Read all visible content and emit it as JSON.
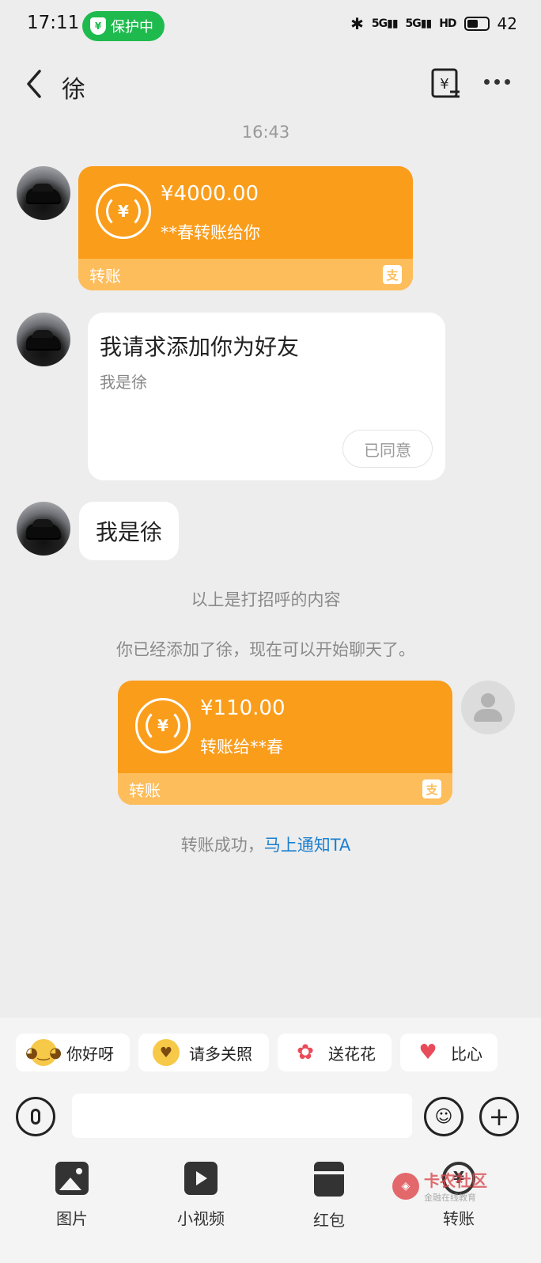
{
  "status_bar": {
    "time": "17:11",
    "protection_label": "保护中",
    "signal1": "5G",
    "signal2": "5G",
    "hd": "HD",
    "battery": "42"
  },
  "header": {
    "title": "徐"
  },
  "messages": {
    "time_separator": "16:43",
    "transfer_in": {
      "amount": "¥4000.00",
      "description": "**春转账给你",
      "label": "转账"
    },
    "friend_request": {
      "title": "我请求添加你为好友",
      "subtitle": "我是徐",
      "button": "已同意"
    },
    "text_message": "我是徐",
    "system_greeting": "以上是打招呼的内容",
    "system_added": "你已经添加了徐，现在可以开始聊天了。",
    "transfer_out": {
      "amount": "¥110.00",
      "description": "转账给**春",
      "label": "转账"
    },
    "transfer_status": "转账成功，",
    "notify_link": "马上通知TA"
  },
  "quick_replies": [
    {
      "label": "你好呀",
      "icon": "smile-emoji-icon"
    },
    {
      "label": "请多关照",
      "icon": "hug-emoji-icon"
    },
    {
      "label": "送花花",
      "icon": "flower-icon"
    },
    {
      "label": "比心",
      "icon": "finger-heart-icon"
    }
  ],
  "toolbar": {
    "photo": "图片",
    "video": "小视频",
    "red_packet": "红包",
    "transfer": "转账"
  },
  "watermark": {
    "brand": "卡农社区",
    "sub": "金融在线教育"
  },
  "colors": {
    "transfer_orange": "#fa9d1b",
    "transfer_footer": "#fdbd5b",
    "link_blue": "#1b7fcf",
    "protect_green": "#1fba4e"
  }
}
